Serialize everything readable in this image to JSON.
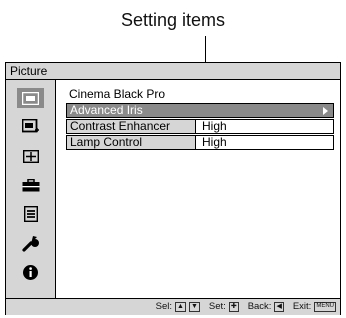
{
  "callout": {
    "text": "Setting items"
  },
  "menu": {
    "title": "Picture",
    "header": "Cinema Black Pro",
    "items": [
      {
        "label": "Advanced Iris",
        "value": "",
        "highlighted": true
      },
      {
        "label": "Contrast Enhancer",
        "value": "High",
        "highlighted": false
      },
      {
        "label": "Lamp Control",
        "value": "High",
        "highlighted": false
      }
    ]
  },
  "sidebar": {
    "icons": [
      "picture-icon",
      "picture-adjust-icon",
      "screen-icon",
      "setup-icon",
      "function-icon",
      "installation-icon",
      "information-icon"
    ],
    "active_index": 0
  },
  "footer": {
    "sel": "Sel:",
    "set": "Set:",
    "back": "Back:",
    "exit": "Exit:",
    "menu_key": "MENU"
  }
}
